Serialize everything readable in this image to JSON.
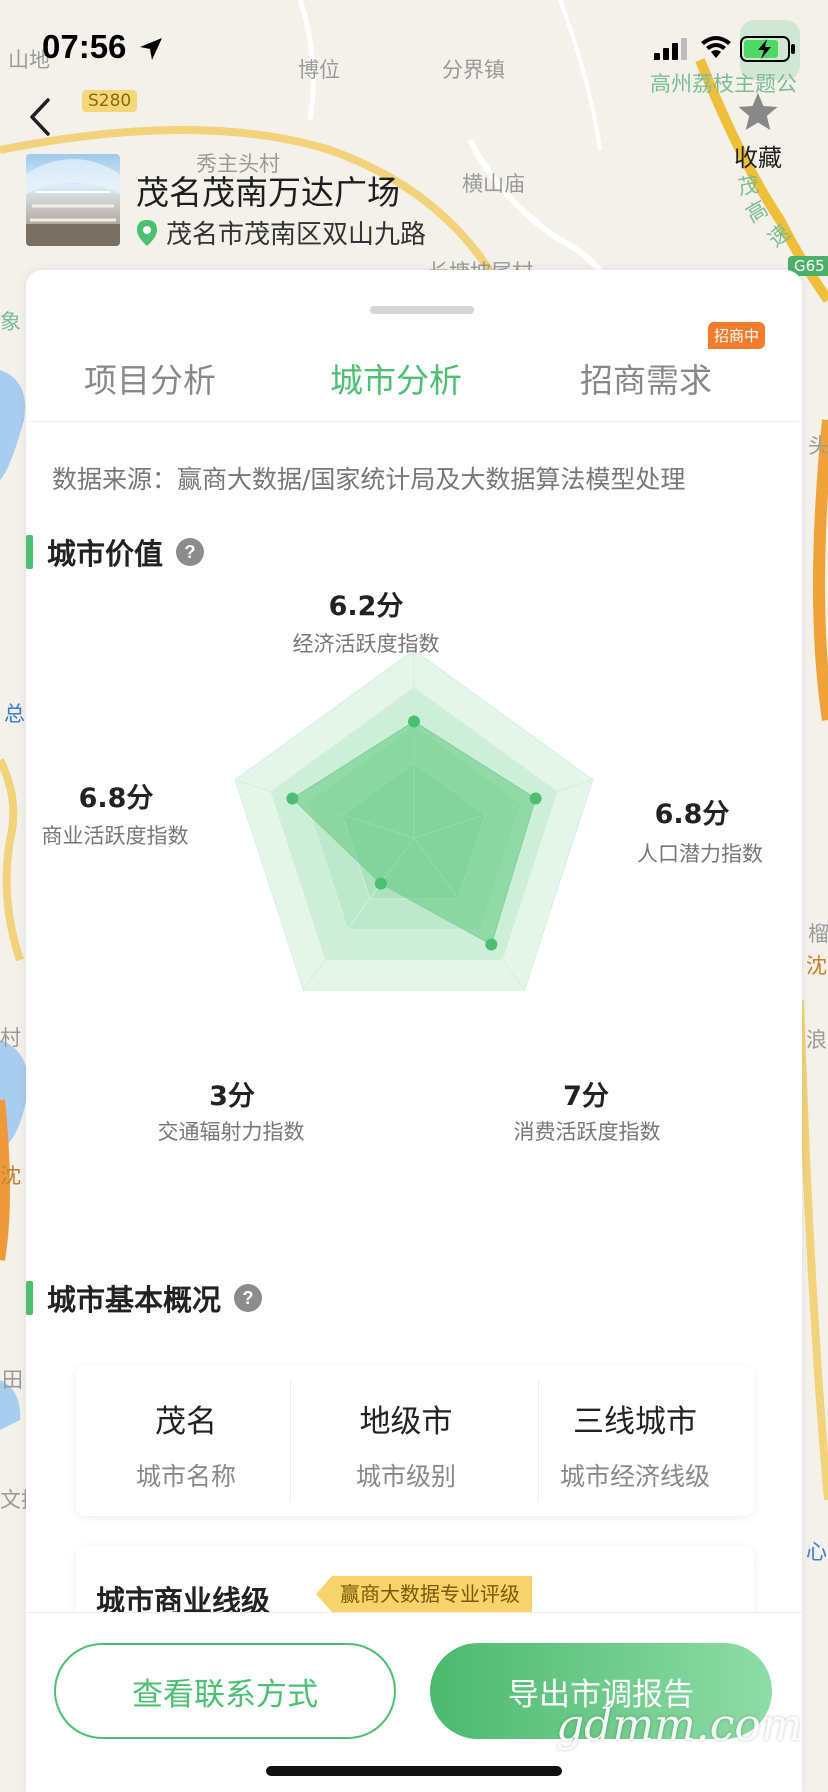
{
  "status_bar": {
    "time": "07:56"
  },
  "map": {
    "labels": [
      "山地",
      "博位",
      "分界镇",
      "高州荔枝主题公",
      "S280",
      "秀主头村",
      "横山庙",
      "茂",
      "高",
      "速",
      "长塘坡尾村",
      "G65",
      "象",
      "头",
      "总",
      "沈",
      "榴",
      "沈",
      "村",
      "田",
      "文扬",
      "浪",
      "心"
    ]
  },
  "header": {
    "back_icon": "chevron-left-icon",
    "favorite_label": "收藏",
    "favorite_icon": "star-icon",
    "project_name": "茂名茂南万达广场",
    "address": "茂名市茂南区双山九路",
    "location_icon": "location-pin-icon"
  },
  "tabs": {
    "items": [
      {
        "label": "项目分析",
        "active": false
      },
      {
        "label": "城市分析",
        "active": true
      },
      {
        "label": "招商需求",
        "active": false
      }
    ],
    "badge": "招商中"
  },
  "source": "数据来源：赢商大数据/国家统计局及大数据算法模型处理",
  "city_value": {
    "title": "城市价值",
    "help_icon": "question-icon",
    "radar_max": 10,
    "dimensions": [
      {
        "score_label": "6.2分",
        "name": "经济活跃度指数",
        "value": 6.2
      },
      {
        "score_label": "6.8分",
        "name": "人口潜力指数",
        "value": 6.8
      },
      {
        "score_label": "7分",
        "name": "消费活跃度指数",
        "value": 7
      },
      {
        "score_label": "3分",
        "name": "交通辐射力指数",
        "value": 3
      },
      {
        "score_label": "6.8分",
        "name": "商业活跃度指数",
        "value": 6.8
      }
    ]
  },
  "city_overview": {
    "title": "城市基本概况",
    "help_icon": "question-icon",
    "cells": [
      {
        "value": "茂名",
        "label": "城市名称"
      },
      {
        "value": "地级市",
        "label": "城市级别"
      },
      {
        "value": "三线城市",
        "label": "城市经济线级"
      }
    ]
  },
  "business_level": {
    "title": "城市商业线级",
    "badge": "赢商大数据专业评级"
  },
  "bottom": {
    "contact_label": "查看联系方式",
    "export_label": "导出市调报告"
  },
  "watermark": "gdmm.com",
  "colors": {
    "accent": "#4cbf72",
    "badge_orange": "#f07c2d",
    "badge_yellow": "#f7d36b"
  }
}
